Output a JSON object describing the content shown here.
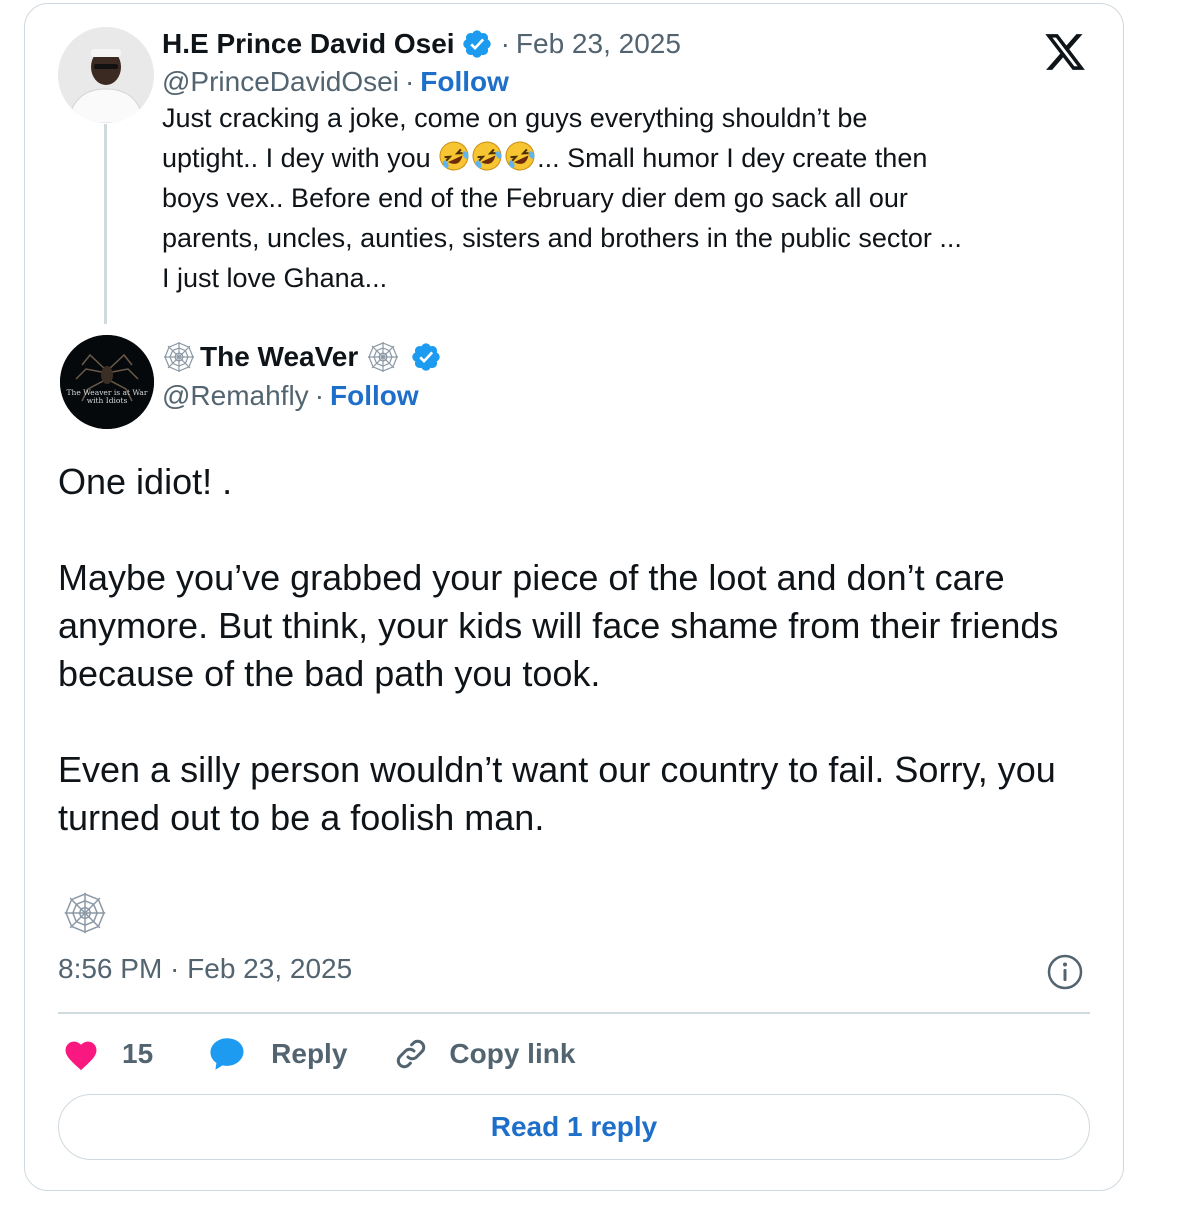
{
  "quoted_tweet": {
    "display_name": "H.E Prince David Osei",
    "date": "Feb 23, 2025",
    "handle": "@PrinceDavidOsei",
    "follow_label": "Follow",
    "text_line1": "Just cracking a joke,  come on guys everything shouldn’t be",
    "text_line2_pre": "uptight.. I dey with you ",
    "text_line2_post": "... Small humor I dey create then",
    "text_rest": "boys vex.. Before  end of the February dier dem go sack all our\nparents, uncles, aunties, sisters and brothers in the public sector ...\nI just love Ghana...",
    "emoji_names": [
      "rolling-on-floor-laughing",
      "rolling-on-floor-laughing",
      "rolling-on-floor-laughing"
    ]
  },
  "tweet": {
    "display_name": "The WeaVer",
    "handle": "@Remahfly",
    "follow_label": "Follow",
    "avatar_caption": "The Weaver is at War with Idiots",
    "paragraphs": [
      "One idiot! .",
      "Maybe you’ve grabbed your piece of the loot and don’t care anymore. But think, your kids will face shame from their friends because of the bad path you took.",
      "Even a silly person wouldn’t want our country to fail. Sorry, you turned out to be a foolish man."
    ],
    "timestamp": "8:56 PM · Feb 23, 2025"
  },
  "actions": {
    "like_count": "15",
    "reply_label": "Reply",
    "copy_label": "Copy link"
  },
  "read_reply_label": "Read 1 reply",
  "colors": {
    "accent_blue": "#1d6fc9",
    "verified_blue": "#1d9bf0",
    "like_pink": "#f91880",
    "reply_blue": "#1d9bf0",
    "muted": "#536471",
    "border": "#cfd9de"
  },
  "icons": [
    "x-logo-icon",
    "verified-badge-icon",
    "spider-web-icon",
    "info-icon",
    "heart-icon",
    "speech-bubble-icon",
    "link-icon"
  ]
}
